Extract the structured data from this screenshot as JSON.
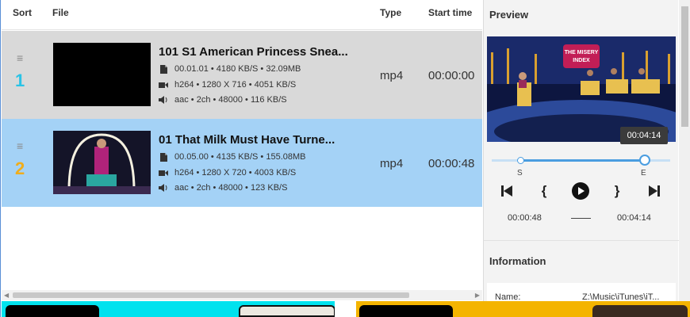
{
  "header": {
    "sort": "Sort",
    "file": "File",
    "type": "Type",
    "start_time": "Start time"
  },
  "rows": [
    {
      "index": "1",
      "index_color": "#29c3e6",
      "title": "101 S1 American Princess Snea...",
      "duration_line": "00.01.01  •  4180 KB/S  •  32.09MB",
      "video_line": "h264  •  1280 X 716  •  4051 KB/S",
      "audio_line": "aac  •  2ch  •  48000  •  116 KB/S",
      "type": "mp4",
      "start_time": "00:00:00"
    },
    {
      "index": "2",
      "index_color": "#f0ad1c",
      "title": "01 That Milk Must Have Turne...",
      "duration_line": "00.05.00  •  4135 KB/S  •  155.08MB",
      "video_line": "h264  •  1280 X 720  •  4003 KB/S",
      "audio_line": "aac  •  2ch  •  48000  •  123 KB/S",
      "type": "mp4",
      "start_time": "00:00:48"
    }
  ],
  "preview": {
    "title": "Preview",
    "tooltip_time": "00:04:14",
    "slider_start_label": "S",
    "slider_end_label": "E",
    "start_bracket": "{",
    "end_bracket": "}",
    "start_time": "00:00:48",
    "end_time": "00:04:14",
    "overlay_text": "THE MISERY INDEX"
  },
  "information": {
    "title": "Information",
    "name_label": "Name:",
    "name_value": "Z:\\Music\\iTunes\\iT..."
  },
  "icons": {
    "drag": "drag-handle-icon",
    "file": "file-icon",
    "video": "video-camera-icon",
    "audio": "speaker-icon"
  },
  "colors": {
    "row_selected": "#a4d2f6",
    "row_normal": "#d9d9d9",
    "accent": "#4a9de0",
    "strip_cyan": "#00e2ee",
    "strip_gold": "#f4b400"
  }
}
